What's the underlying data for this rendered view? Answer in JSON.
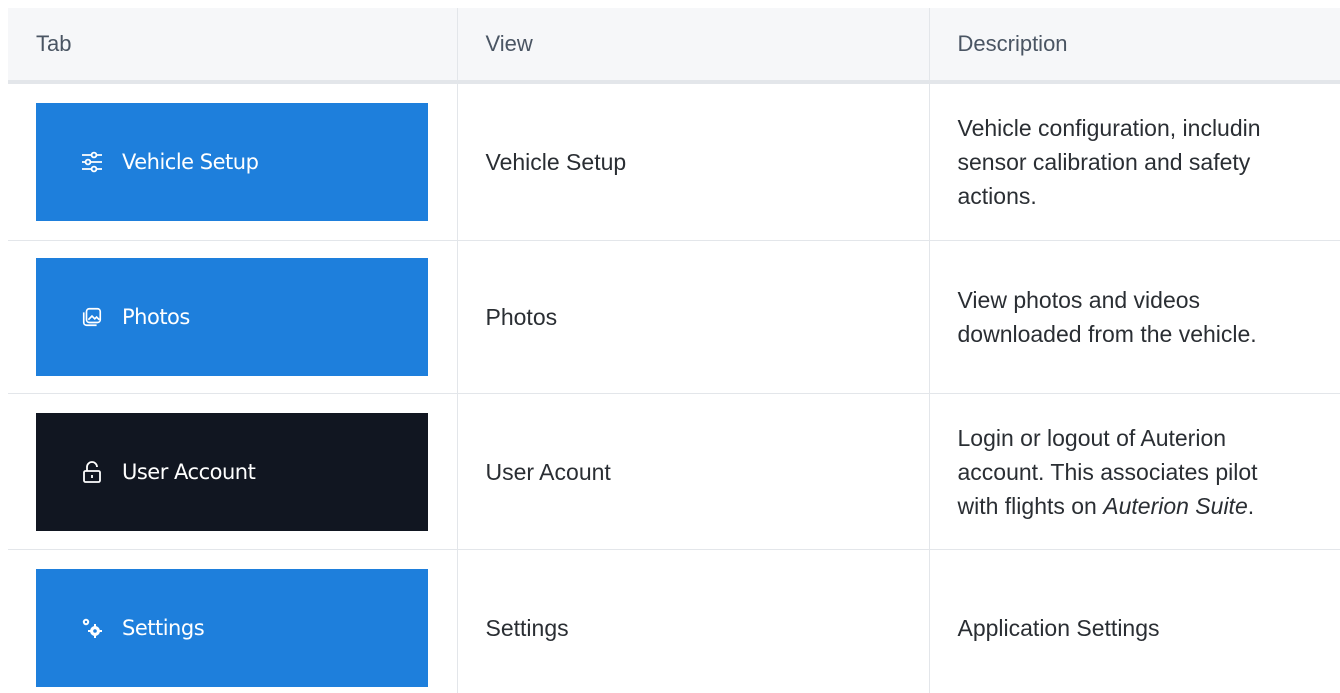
{
  "table": {
    "headers": [
      "Tab",
      "View",
      "Description"
    ],
    "rows": [
      {
        "tab_label": "Vehicle Setup",
        "tab_icon": "sliders-icon",
        "tab_bg": "#1e7fdc",
        "view": "Vehicle Setup",
        "description_lines": [
          "Vehicle configuration, includin",
          "sensor calibration and safety",
          "actions."
        ]
      },
      {
        "tab_label": "Photos",
        "tab_icon": "photos-icon",
        "tab_bg": "#1e7fdc",
        "view": "Photos",
        "description_lines": [
          "View photos and videos",
          "downloaded from the vehicle."
        ]
      },
      {
        "tab_label": "User Account",
        "tab_icon": "unlock-icon",
        "tab_bg": "#111621",
        "view": "User Acount",
        "description_lines": [
          "Login or logout of Auterion",
          "account. This associates pilot"
        ],
        "description_last_prefix": "with flights on ",
        "description_last_emphasis": "Auterion Suite",
        "description_last_suffix": "."
      },
      {
        "tab_label": "Settings",
        "tab_icon": "gears-icon",
        "tab_bg": "#1e7fdc",
        "view": "Settings",
        "description_lines": [
          "Application Settings"
        ]
      }
    ]
  }
}
